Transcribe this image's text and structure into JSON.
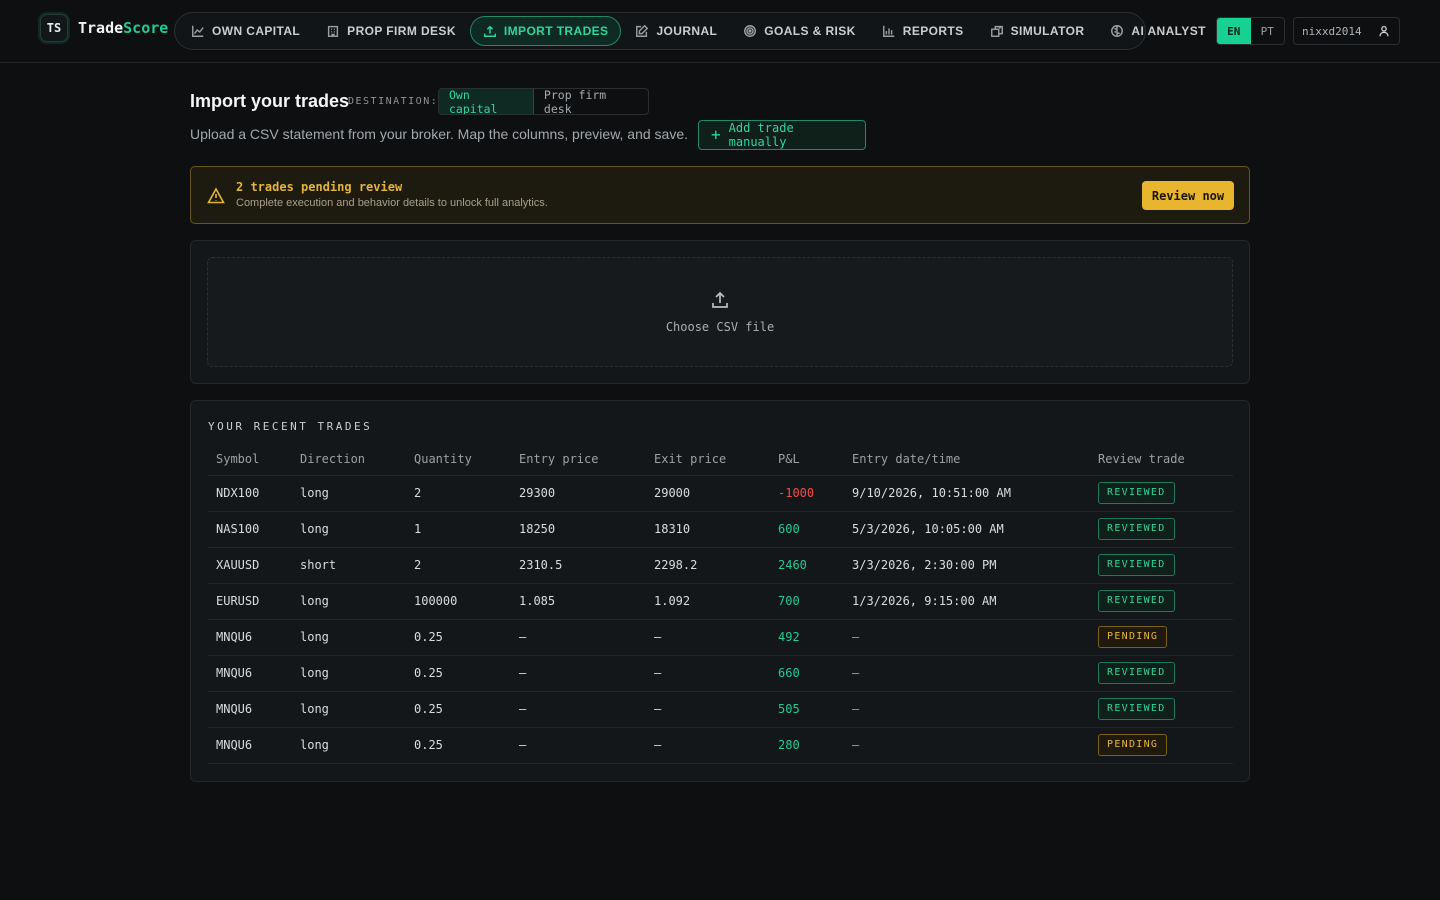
{
  "app": {
    "logo_mark": "TS",
    "name_part1": "Trade",
    "name_part2": "Score",
    "accent": "#22c993"
  },
  "nav": {
    "items": [
      {
        "label": "OWN CAPITAL",
        "icon": "chart-line-icon",
        "active": false
      },
      {
        "label": "PROP FIRM DESK",
        "icon": "building-icon",
        "active": false
      },
      {
        "label": "IMPORT TRADES",
        "icon": "upload-icon",
        "active": true
      },
      {
        "label": "JOURNAL",
        "icon": "edit-icon",
        "active": false
      },
      {
        "label": "GOALS & RISK",
        "icon": "target-icon",
        "active": false
      },
      {
        "label": "REPORTS",
        "icon": "bar-chart-icon",
        "active": false
      },
      {
        "label": "SIMULATOR",
        "icon": "simulator-icon",
        "active": false
      },
      {
        "label": "AI ANALYST",
        "icon": "brain-icon",
        "active": false
      }
    ]
  },
  "lang": {
    "en": "EN",
    "pt": "PT",
    "selected": "EN"
  },
  "user": {
    "name": "nixxd2014",
    "icon": "user-icon"
  },
  "header": {
    "title": "Import your trades",
    "destination_label": "DESTINATION:",
    "destination_options": [
      "Own capital",
      "Prop firm desk"
    ],
    "destination_selected": "Own capital",
    "subtitle": "Upload a CSV statement from your broker. Map the columns, preview, and save.",
    "add_manual_label": "Add trade manually"
  },
  "banner": {
    "title": "2 trades pending review",
    "text": "Complete execution and behavior details to unlock full analytics.",
    "button": "Review now",
    "icon": "warning-icon",
    "color": "#e2b53a"
  },
  "upload": {
    "label": "Choose CSV file",
    "icon": "upload-icon"
  },
  "recent_trades": {
    "heading": "YOUR RECENT TRADES",
    "columns": [
      "Symbol",
      "Direction",
      "Quantity",
      "Entry price",
      "Exit price",
      "P&L",
      "Entry date/time",
      "Review trade"
    ],
    "rows": [
      {
        "symbol": "NDX100",
        "direction": "long",
        "quantity": "2",
        "entry": "29300",
        "exit": "29000",
        "pnl": "-1000",
        "datetime": "9/10/2026, 10:51:00 AM",
        "review": "REVIEWED"
      },
      {
        "symbol": "NAS100",
        "direction": "long",
        "quantity": "1",
        "entry": "18250",
        "exit": "18310",
        "pnl": "600",
        "datetime": "5/3/2026, 10:05:00 AM",
        "review": "REVIEWED"
      },
      {
        "symbol": "XAUUSD",
        "direction": "short",
        "quantity": "2",
        "entry": "2310.5",
        "exit": "2298.2",
        "pnl": "2460",
        "datetime": "3/3/2026, 2:30:00 PM",
        "review": "REVIEWED"
      },
      {
        "symbol": "EURUSD",
        "direction": "long",
        "quantity": "100000",
        "entry": "1.085",
        "exit": "1.092",
        "pnl": "700",
        "datetime": "1/3/2026, 9:15:00 AM",
        "review": "REVIEWED"
      },
      {
        "symbol": "MNQU6",
        "direction": "long",
        "quantity": "0.25",
        "entry": "—",
        "exit": "—",
        "pnl": "492",
        "datetime": "—",
        "review": "PENDING"
      },
      {
        "symbol": "MNQU6",
        "direction": "long",
        "quantity": "0.25",
        "entry": "—",
        "exit": "—",
        "pnl": "660",
        "datetime": "—",
        "review": "REVIEWED"
      },
      {
        "symbol": "MNQU6",
        "direction": "long",
        "quantity": "0.25",
        "entry": "—",
        "exit": "—",
        "pnl": "505",
        "datetime": "—",
        "review": "REVIEWED"
      },
      {
        "symbol": "MNQU6",
        "direction": "long",
        "quantity": "0.25",
        "entry": "—",
        "exit": "—",
        "pnl": "280",
        "datetime": "—",
        "review": "PENDING"
      }
    ],
    "colors": {
      "positive": "#22c993",
      "negative": "#ef4d4d",
      "pending": "#e2b53a"
    }
  }
}
